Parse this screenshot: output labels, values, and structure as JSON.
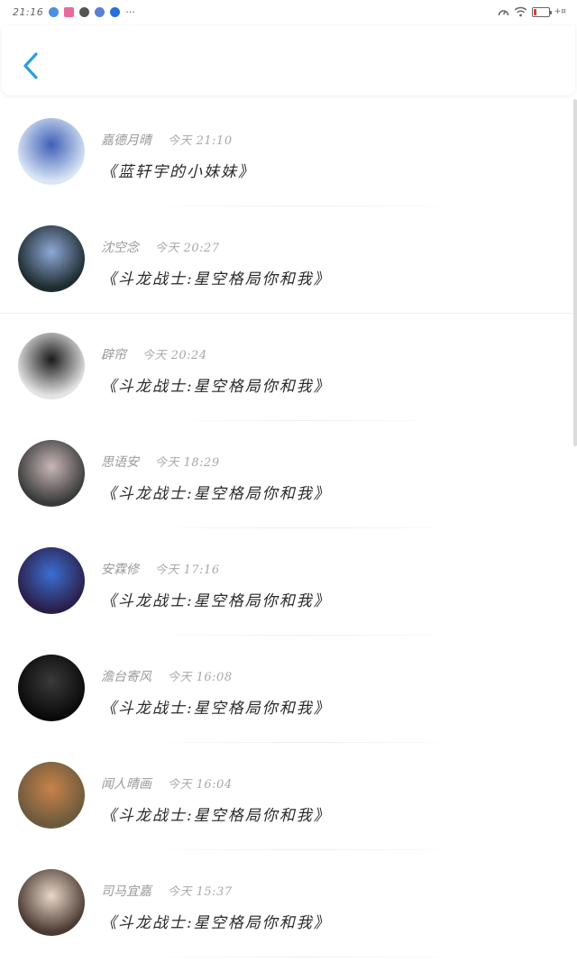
{
  "status_bar": {
    "time": "21:16",
    "dots": "···",
    "right_text": "+¤",
    "app_icons": [
      "#4a90e2",
      "#e86b9b",
      "#555555",
      "#5b7fd6",
      "#2a6fdb"
    ]
  },
  "header": {
    "back_icon": "chevron-left-icon",
    "accent": "#2f9ce0"
  },
  "comments": [
    {
      "name": "嘉德月晴",
      "time": "今天 21:10",
      "message": "《蓝轩宇的小妹妹》",
      "avatar_colors": [
        "#d9e6f5",
        "#3f5fb8"
      ]
    },
    {
      "name": "沈空念",
      "time": "今天 20:27",
      "message": "《斗龙战士:星空格局你和我》",
      "avatar_colors": [
        "#1d2b2e",
        "#8fa8d8"
      ]
    },
    {
      "name": "辟帘",
      "time": "今天 20:24",
      "message": "《斗龙战士:星空格局你和我》",
      "avatar_colors": [
        "#e4e4e4",
        "#1a1a1a"
      ]
    },
    {
      "name": "思语安",
      "time": "今天 18:29",
      "message": "《斗龙战士:星空格局你和我》",
      "avatar_colors": [
        "#3a3a3a",
        "#c9b7b7"
      ]
    },
    {
      "name": "安霖修",
      "time": "今天 17:16",
      "message": "《斗龙战士:星空格局你和我》",
      "avatar_colors": [
        "#2a1f4a",
        "#3c6fd1"
      ]
    },
    {
      "name": "澹台寄风",
      "time": "今天 16:08",
      "message": "《斗龙战士:星空格局你和我》",
      "avatar_colors": [
        "#0a0a0a",
        "#3a3a3a"
      ]
    },
    {
      "name": "闻人晴画",
      "time": "今天 16:04",
      "message": "《斗龙战士:星空格局你和我》",
      "avatar_colors": [
        "#6b5a3c",
        "#c9824a"
      ]
    },
    {
      "name": "司马宜嘉",
      "time": "今天 15:37",
      "message": "《斗龙战士:星空格局你和我》",
      "avatar_colors": [
        "#4a3a32",
        "#e9d8c8"
      ]
    }
  ]
}
